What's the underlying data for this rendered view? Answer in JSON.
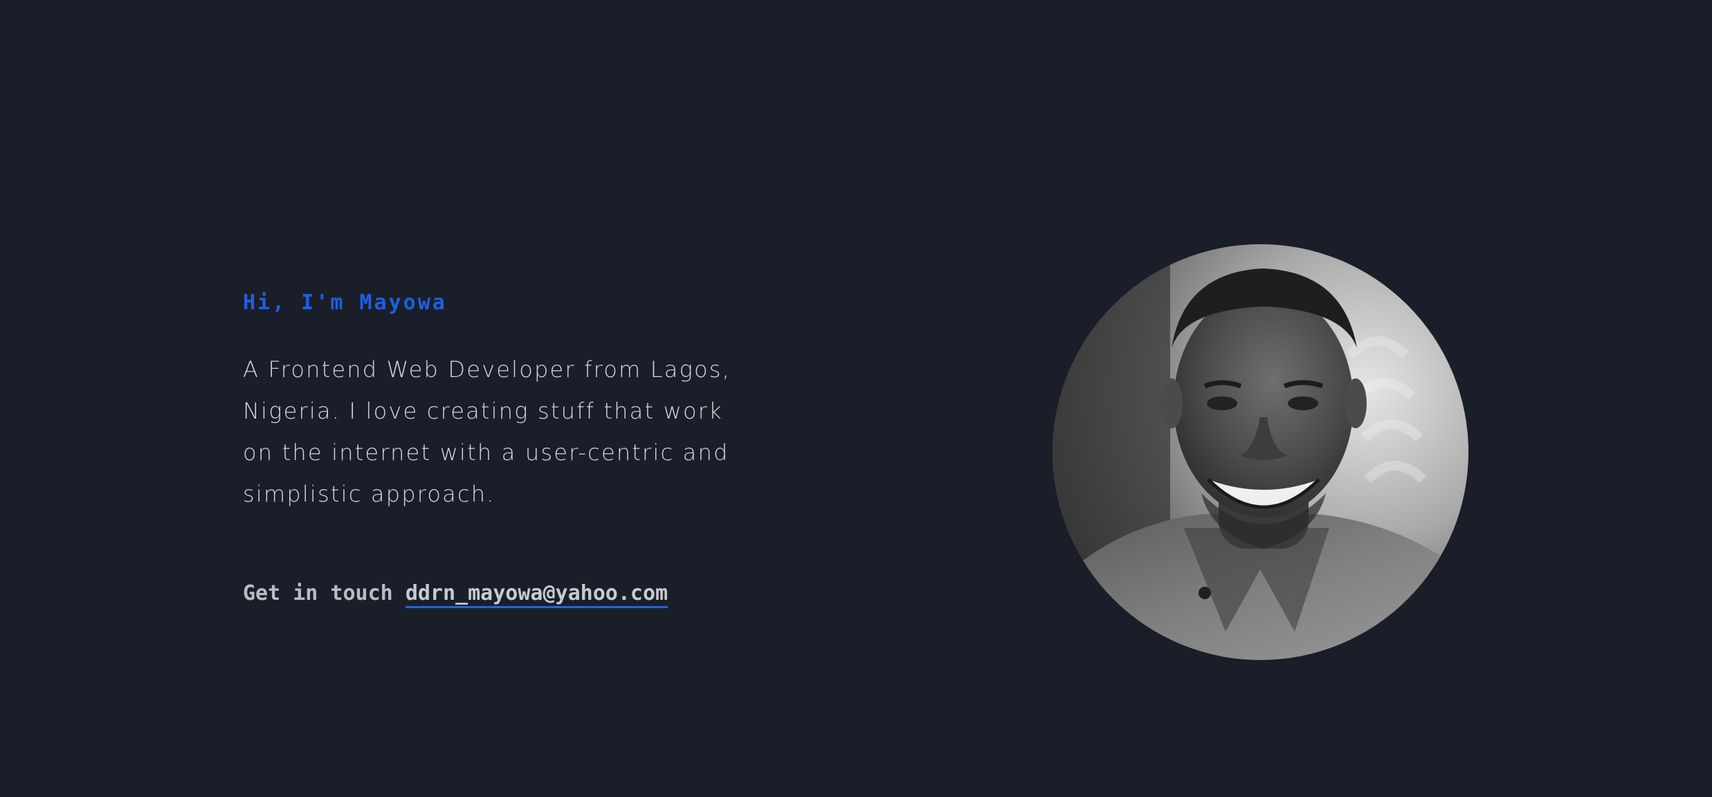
{
  "hero": {
    "greeting": "Hi, I'm Mayowa",
    "bio": "A Frontend Web Developer from Lagos, Nigeria. I love creating stuff that work on the internet with a user-centric and simplistic approach.",
    "contact_prefix": "Get in touch",
    "email": "ddrn_mayowa@yahoo.com"
  },
  "colors": {
    "background": "#1a1e29",
    "accent": "#1f5fe0",
    "text": "#d4d7dd"
  },
  "portrait": {
    "icon": "profile-photo",
    "style": "grayscale circular headshot"
  }
}
